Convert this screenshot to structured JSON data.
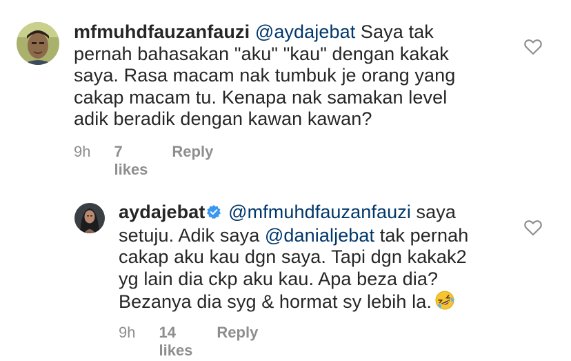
{
  "comments": [
    {
      "username": "mfmuhdfauzanfauzi",
      "mention": "@aydajebat",
      "lines": [
        " Saya tak",
        "pernah bahasakan \"aku\" \"kau\" dengan kakak",
        "saya. Rasa macam nak tumbuk je orang yang",
        "cakap macam tu. Kenapa nak samakan level",
        "adik beradik dengan kawan kawan?"
      ],
      "time": "9h",
      "likes": "7 likes",
      "reply": "Reply"
    },
    {
      "username": "aydajebat",
      "mention": "@mfmuhdfauzanfauzi",
      "line1_tail": " saya",
      "line2_pre": "setuju. Adik saya ",
      "line2_mention": "@danialjebat",
      "line2_post": " tak pernah",
      "lines": [
        "cakap aku kau dgn saya. Tapi dgn kakak2",
        "yg lain dia ckp aku kau. Apa beza dia?",
        "Bezanya dia syg & hormat sy lebih la."
      ],
      "time": "9h",
      "likes": "14 likes",
      "reply": "Reply"
    }
  ],
  "icons": {
    "heart": "heart-outline-icon",
    "verified": "verified-badge-icon",
    "emoji": "rolling-on-floor-laughing-emoji"
  },
  "colors": {
    "text": "#262626",
    "mention": "#00376b",
    "meta": "#8e8e8e",
    "verified": "#3897f0"
  }
}
